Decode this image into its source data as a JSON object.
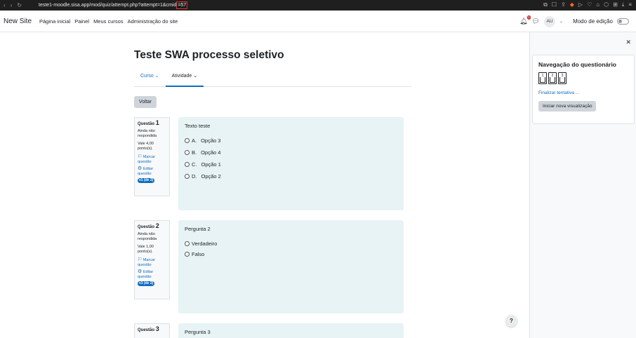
{
  "browser": {
    "url_prefix": "teste1-moodle.sisa.app/mod/quiz/attempt.php?attempt=1&cmid",
    "url_highlight": "=57"
  },
  "navbar": {
    "site_name": "New Site",
    "links": [
      "Página inicial",
      "Painel",
      "Meus cursos",
      "Administração do site"
    ],
    "notification_count": "1",
    "avatar_initials": "AU",
    "edit_mode_label": "Modo de edição"
  },
  "page": {
    "title": "Teste SWA processo seletivo",
    "tabs": [
      {
        "label": "Curso",
        "active": false
      },
      {
        "label": "Atividade",
        "active": true
      }
    ],
    "back_label": "Voltar"
  },
  "questions": [
    {
      "label": "Questão",
      "number": "1",
      "state": "Ainda não respondida",
      "grade": "Vale 4,00 ponto(s).",
      "flag": "Marcar questão",
      "edit": "Editar questão",
      "version": "v1 (de 2)",
      "text": "Texto teste",
      "answers": [
        {
          "letter": "A.",
          "text": "Opção 3"
        },
        {
          "letter": "B.",
          "text": "Opção 4"
        },
        {
          "letter": "C.",
          "text": "Opção 1"
        },
        {
          "letter": "D.",
          "text": "Opção 2"
        }
      ]
    },
    {
      "label": "Questão",
      "number": "2",
      "state": "Ainda não respondida",
      "grade": "Vale 1,00 ponto(s).",
      "flag": "Marcar questão",
      "edit": "Editar questão",
      "version": "v1 (de 2)",
      "text": "Pergunta 2",
      "answers": [
        {
          "letter": "",
          "text": "Verdadeiro"
        },
        {
          "letter": "",
          "text": "Falso"
        }
      ]
    },
    {
      "label": "Questão",
      "number": "3",
      "text": "Pergunta 3"
    }
  ],
  "drawer": {
    "title": "Navegação do questionário",
    "question_buttons": [
      "1",
      "2",
      "3"
    ],
    "finish_link": "Finalizar tentativa ...",
    "restart_button": "Iniciar nova visualização"
  },
  "help_label": "?"
}
